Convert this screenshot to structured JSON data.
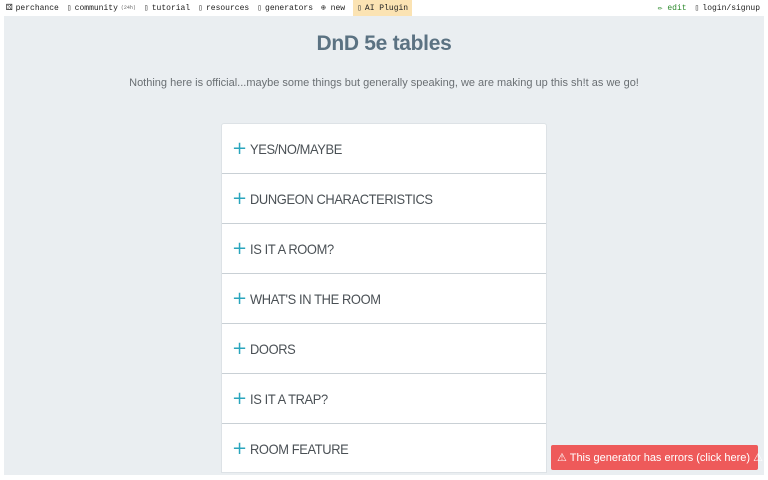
{
  "topbar": {
    "logo_icon": "⚄",
    "logo_label": "perchance",
    "community_label": "community",
    "community_count": "(24h)",
    "tutorial_label": "tutorial",
    "resources_label": "resources",
    "generators_label": "generators",
    "new_label": "⊕ new",
    "ai_plugin_label": "AI Plugin",
    "edit_label": "✏ edit",
    "login_label": "login/signup"
  },
  "page": {
    "title": "DnD 5e tables",
    "subtitle": "Nothing here is official...maybe some things but generally speaking, we are making up this sh!t as we go!"
  },
  "accordion": {
    "items": [
      {
        "label": "YES/NO/MAYBE"
      },
      {
        "label": "DUNGEON CHARACTERISTICS"
      },
      {
        "label": "IS IT A ROOM?"
      },
      {
        "label": "WHAT'S IN THE ROOM"
      },
      {
        "label": "DOORS"
      },
      {
        "label": "IS IT A TRAP?"
      },
      {
        "label": "ROOM FEATURE"
      }
    ]
  },
  "error_toast": {
    "text": "⚠ This generator has errors (click here) ⚠"
  },
  "colors": {
    "accent_plus": "#2aa6bd",
    "title": "#5b7282",
    "error_bg": "#ee5a5a",
    "ai_plugin_bg": "#fbe3b3"
  }
}
